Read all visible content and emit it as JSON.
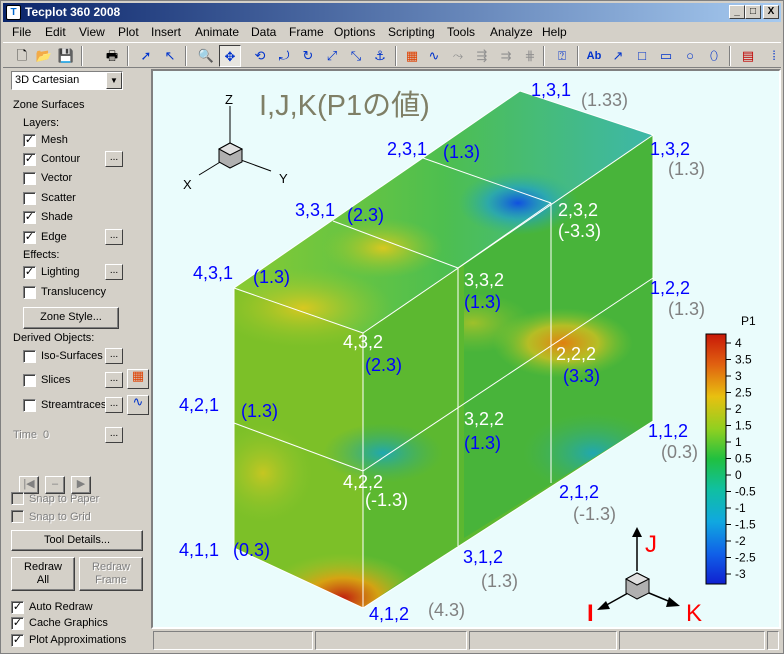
{
  "window": {
    "title": "Tecplot 360 2008",
    "controls": [
      "_",
      "□",
      "X"
    ]
  },
  "menu": [
    "File",
    "Edit",
    "View",
    "Plot",
    "Insert",
    "Animate",
    "Data",
    "Frame",
    "Options",
    "Scripting",
    "Tools",
    "Analyze",
    "Help"
  ],
  "sidebar": {
    "plot_type": "3D Cartesian",
    "zone_surfaces": "Zone Surfaces",
    "layers_label": "Layers:",
    "layers": [
      {
        "label": "Mesh",
        "checked": true
      },
      {
        "label": "Contour",
        "checked": true
      },
      {
        "label": "Vector",
        "checked": false
      },
      {
        "label": "Scatter",
        "checked": false
      },
      {
        "label": "Shade",
        "checked": true
      },
      {
        "label": "Edge",
        "checked": true
      }
    ],
    "effects_label": "Effects:",
    "effects": [
      {
        "label": "Lighting",
        "checked": true
      },
      {
        "label": "Translucency",
        "checked": false
      }
    ],
    "zone_style_button": "Zone Style...",
    "derived_label": "Derived Objects:",
    "derived": [
      {
        "label": "Iso-Surfaces",
        "checked": false
      },
      {
        "label": "Slices",
        "checked": false
      },
      {
        "label": "Streamtraces",
        "checked": false
      }
    ],
    "time_label": "Time",
    "time_value": "0",
    "snap_to_paper": "Snap to Paper",
    "snap_to_grid": "Snap to Grid",
    "tool_details_button": "Tool Details...",
    "redraw_all_line1": "Redraw",
    "redraw_all_line2": "All",
    "redraw_frame_line1": "Redraw",
    "redraw_frame_line2": "Frame",
    "bottom_checks": [
      {
        "label": "Auto Redraw",
        "checked": true
      },
      {
        "label": "Cache Graphics",
        "checked": true
      },
      {
        "label": "Plot Approximations",
        "checked": true
      }
    ]
  },
  "plot": {
    "title": "I,J,K(P1の値)",
    "axes": {
      "z": "Z",
      "x": "X",
      "y": "Y"
    },
    "index_axes": {
      "i": "I",
      "j": "J",
      "k": "K"
    },
    "legend": {
      "title": "P1",
      "levels": [
        "4",
        "3.5",
        "3",
        "2.5",
        "2",
        "1.5",
        "1",
        "0.5",
        "0",
        "-0.5",
        "-1",
        "-1.5",
        "-2",
        "-2.5",
        "-3"
      ]
    },
    "nodes": [
      {
        "idx": "1,3,1",
        "val": "(1.33)"
      },
      {
        "idx": "2,3,1",
        "val": "(1.3)"
      },
      {
        "idx": "1,3,2",
        "val": "(1.3)"
      },
      {
        "idx": "3,3,1",
        "val": "(2.3)"
      },
      {
        "idx": "2,3,2",
        "val": "(-3.3)"
      },
      {
        "idx": "4,3,1",
        "val": "(1.3)"
      },
      {
        "idx": "3,3,2",
        "val": "(1.3)"
      },
      {
        "idx": "1,2,2",
        "val": "(1.3)"
      },
      {
        "idx": "4,3,2",
        "val": "(2.3)"
      },
      {
        "idx": "2,2,2",
        "val": "(3.3)"
      },
      {
        "idx": "4,2,1",
        "val": "(1.3)"
      },
      {
        "idx": "3,2,2",
        "val": "(1.3)"
      },
      {
        "idx": "1,1,2",
        "val": "(0.3)"
      },
      {
        "idx": "4,2,2",
        "val": "(-1.3)"
      },
      {
        "idx": "2,1,2",
        "val": "(-1.3)"
      },
      {
        "idx": "4,1,1",
        "val": "(0.3)"
      },
      {
        "idx": "3,1,2",
        "val": "(1.3)"
      },
      {
        "idx": "4,1,2",
        "val": "(4.3)"
      }
    ]
  }
}
